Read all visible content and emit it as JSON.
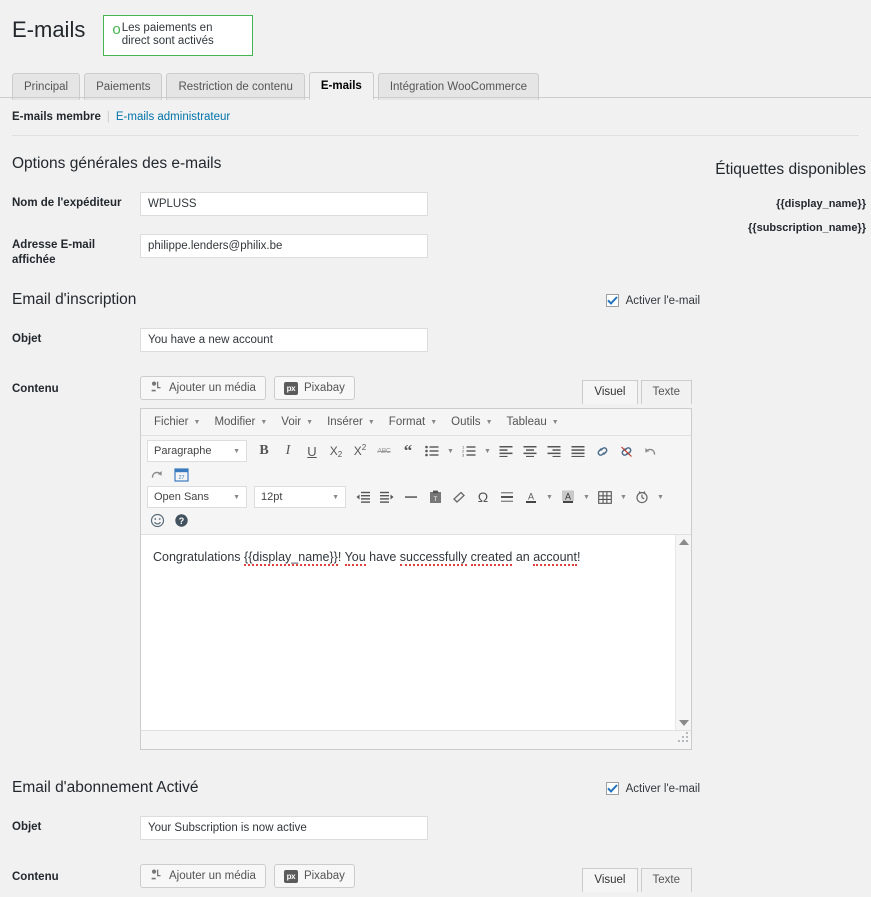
{
  "header": {
    "title": "E-mails",
    "notice": {
      "mark": "o",
      "text": "Les paiements en direct sont activés"
    }
  },
  "tabs": [
    {
      "label": "Principal",
      "active": false
    },
    {
      "label": "Paiements",
      "active": false
    },
    {
      "label": "Restriction de contenu",
      "active": false
    },
    {
      "label": "E-mails",
      "active": true
    },
    {
      "label": "Intégration WooCommerce",
      "active": false
    }
  ],
  "subnav": {
    "current": "E-mails membre",
    "separator": "|",
    "link": "E-mails administrateur"
  },
  "sidebar": {
    "title": "Étiquettes disponibles",
    "tags": [
      "{{display_name}}",
      "{{subscription_name}}"
    ]
  },
  "general": {
    "title": "Options générales des e-mails",
    "sender_name": {
      "label": "Nom de l'expéditeur",
      "value": "WPLUSS"
    },
    "sender_email": {
      "label": "Adresse E-mail affichée",
      "value": "philippe.lenders@philix.be"
    }
  },
  "editor_ui": {
    "add_media": "Ajouter un média",
    "pixabay": "Pixabay",
    "pixabay_icon_text": "px",
    "view_tabs": [
      {
        "label": "Visuel",
        "active": true
      },
      {
        "label": "Texte",
        "active": false
      }
    ],
    "menus": [
      "Fichier",
      "Modifier",
      "Voir",
      "Insérer",
      "Format",
      "Outils",
      "Tableau"
    ],
    "selects": {
      "paragraph": "Paragraphe",
      "font": "Open Sans",
      "size": "12pt"
    },
    "calendar_day": "27"
  },
  "sections": [
    {
      "title": "Email d'inscription",
      "enable_label": "Activer l'e-mail",
      "enabled": true,
      "subject_label": "Objet",
      "subject_value": "You have a new account",
      "content_label": "Contenu",
      "content_parts": [
        {
          "text": "Congratulations ",
          "spell": false
        },
        {
          "text": "{{display_name}}",
          "spell": true
        },
        {
          "text": "! ",
          "spell": false
        },
        {
          "text": "You",
          "spell": true
        },
        {
          "text": " have ",
          "spell": false
        },
        {
          "text": "successfully",
          "spell": true
        },
        {
          "text": " ",
          "spell": false
        },
        {
          "text": "created",
          "spell": true
        },
        {
          "text": " an ",
          "spell": false
        },
        {
          "text": "account",
          "spell": true
        },
        {
          "text": "!",
          "spell": false
        }
      ]
    },
    {
      "title": "Email d'abonnement Activé",
      "enable_label": "Activer l'e-mail",
      "enabled": true,
      "subject_label": "Objet",
      "subject_value": "Your Subscription is now active",
      "content_label": "Contenu"
    }
  ],
  "colors": {
    "background": "#f1f1f1",
    "notice_border": "#46b450",
    "link": "#0073aa",
    "checkbox_check": "#1e73be",
    "spellcheck_underline": "#e04040"
  }
}
